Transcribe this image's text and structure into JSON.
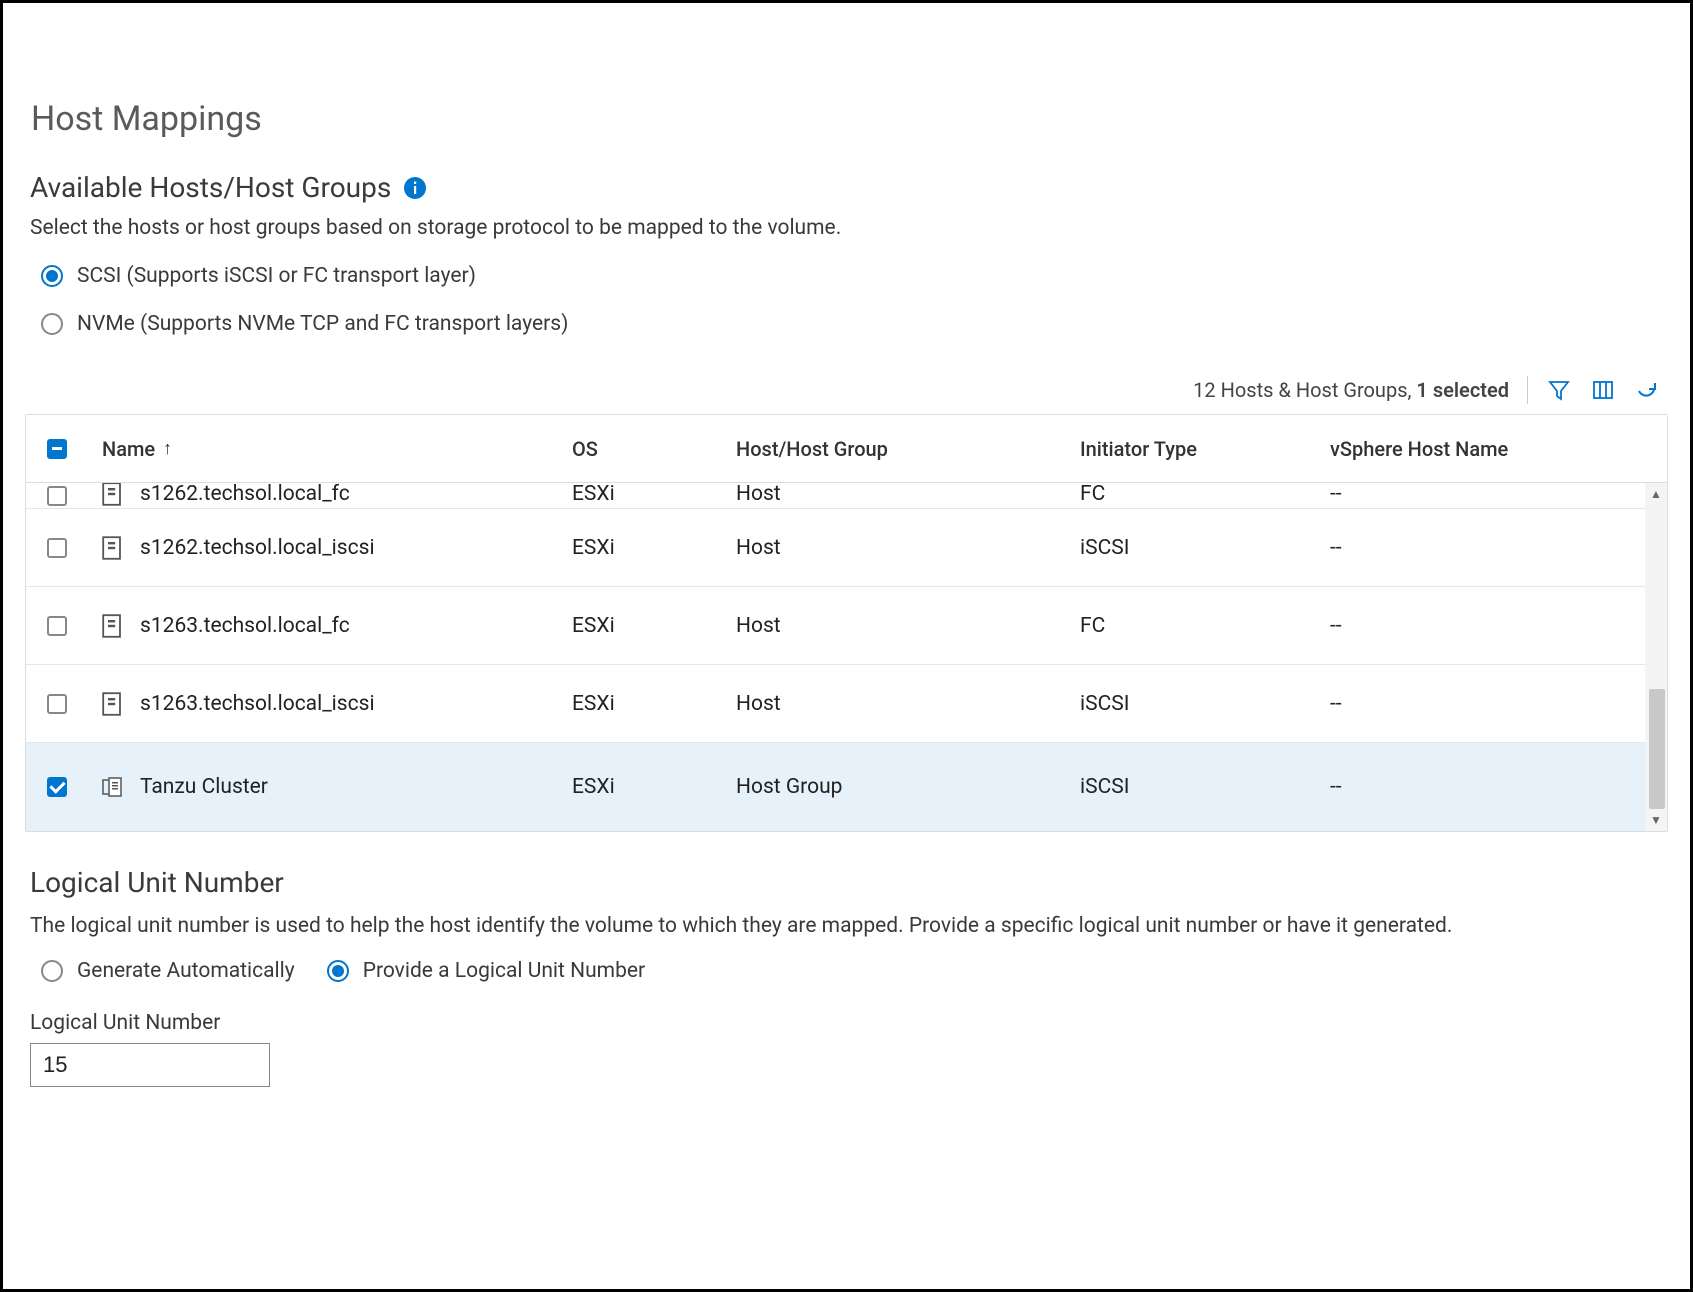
{
  "page": {
    "title": "Host Mappings"
  },
  "hosts_section": {
    "title": "Available Hosts/Host Groups",
    "description": "Select the hosts or host groups based on storage protocol to be mapped to the volume.",
    "protocol_options": {
      "scsi": "SCSI (Supports iSCSI or FC transport layer)",
      "nvme": "NVMe (Supports NVMe TCP and FC transport layers)"
    },
    "meta": {
      "count_text": "12 Hosts & Host Groups,",
      "selected_text": "1 selected"
    },
    "columns": {
      "name": "Name",
      "os": "OS",
      "type": "Host/Host Group",
      "initiator": "Initiator Type",
      "vsphere": "vSphere Host Name"
    },
    "rows": [
      {
        "checked": false,
        "icon": "host",
        "name": "s1262.techsol.local_fc",
        "os": "ESXi",
        "type": "Host",
        "initiator": "FC",
        "vsphere": "--",
        "partial": true
      },
      {
        "checked": false,
        "icon": "host",
        "name": "s1262.techsol.local_iscsi",
        "os": "ESXi",
        "type": "Host",
        "initiator": "iSCSI",
        "vsphere": "--"
      },
      {
        "checked": false,
        "icon": "host",
        "name": "s1263.techsol.local_fc",
        "os": "ESXi",
        "type": "Host",
        "initiator": "FC",
        "vsphere": "--"
      },
      {
        "checked": false,
        "icon": "host",
        "name": "s1263.techsol.local_iscsi",
        "os": "ESXi",
        "type": "Host",
        "initiator": "iSCSI",
        "vsphere": "--"
      },
      {
        "checked": true,
        "icon": "group",
        "name": "Tanzu Cluster",
        "os": "ESXi",
        "type": "Host Group",
        "initiator": "iSCSI",
        "vsphere": "--"
      }
    ]
  },
  "lun_section": {
    "title": "Logical Unit Number",
    "description": "The logical unit number is used to help the host identify the volume to which they are mapped. Provide a specific logical unit number or have it generated.",
    "options": {
      "auto": "Generate Automatically",
      "manual": "Provide a Logical Unit Number"
    },
    "field_label": "Logical Unit Number",
    "value": "15"
  }
}
